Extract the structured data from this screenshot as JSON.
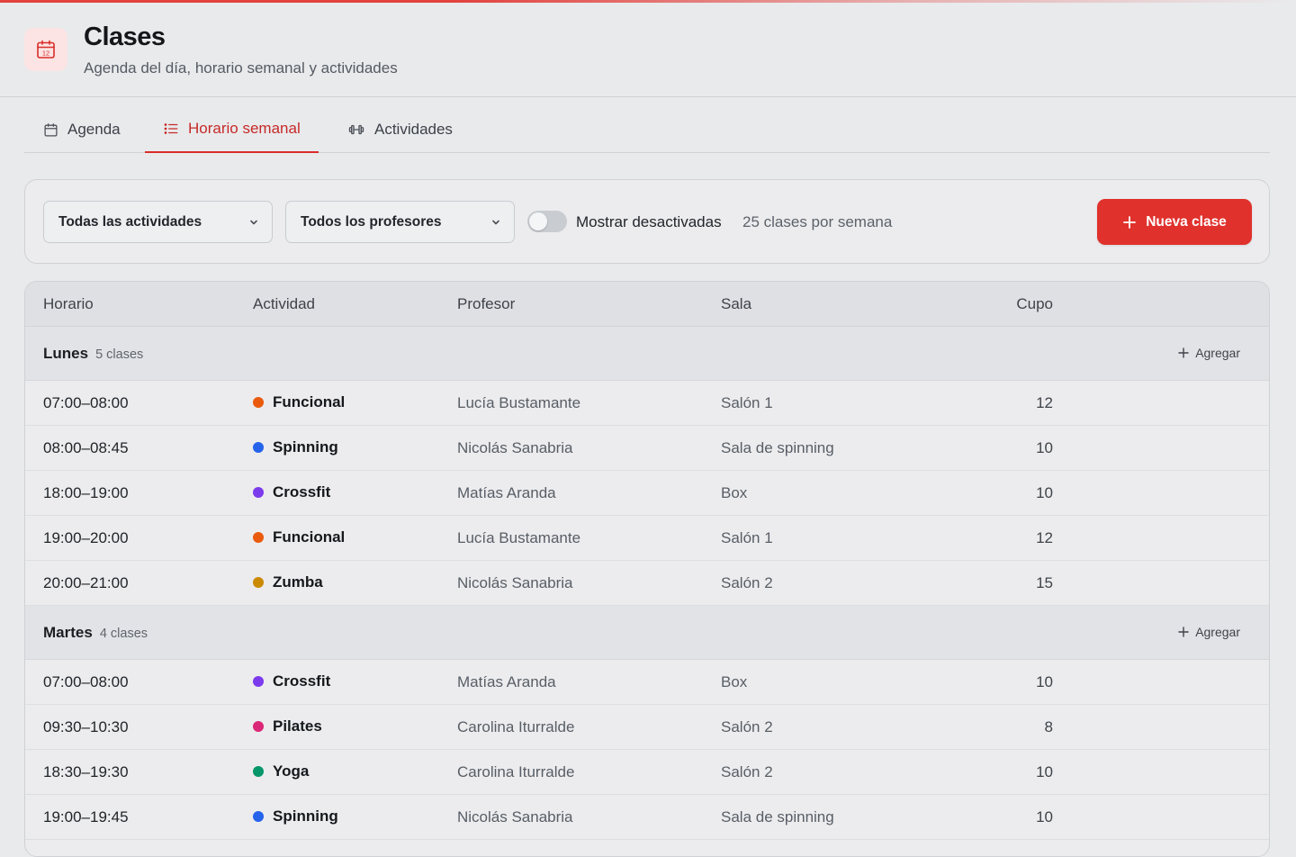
{
  "header": {
    "title": "Clases",
    "subtitle": "Agenda del día, horario semanal y actividades",
    "icon": "calendar-icon",
    "icon_day": "12"
  },
  "tabs": [
    {
      "label": "Agenda",
      "icon": "calendar-icon",
      "active": false
    },
    {
      "label": "Horario semanal",
      "icon": "list-icon",
      "active": true
    },
    {
      "label": "Actividades",
      "icon": "dumbbell-icon",
      "active": false
    }
  ],
  "filters": {
    "activity_select": "Todas las actividades",
    "teacher_select": "Todos los profesores",
    "toggle_label": "Mostrar desactivadas",
    "toggle_on": false,
    "count_label": "25 clases por semana",
    "new_button": "Nueva clase"
  },
  "table": {
    "columns": [
      "Horario",
      "Actividad",
      "Profesor",
      "Sala",
      "Cupo"
    ],
    "add_label": "Agregar",
    "groups": [
      {
        "day": "Lunes",
        "count": "5 clases",
        "rows": [
          {
            "time": "07:00–08:00",
            "activity": "Funcional",
            "color": "#ea5a0c",
            "teacher": "Lucía Bustamante",
            "room": "Salón 1",
            "cupo": "12"
          },
          {
            "time": "08:00–08:45",
            "activity": "Spinning",
            "color": "#2563eb",
            "teacher": "Nicolás Sanabria",
            "room": "Sala de spinning",
            "cupo": "10"
          },
          {
            "time": "18:00–19:00",
            "activity": "Crossfit",
            "color": "#7c3aed",
            "teacher": "Matías Aranda",
            "room": "Box",
            "cupo": "10"
          },
          {
            "time": "19:00–20:00",
            "activity": "Funcional",
            "color": "#ea5a0c",
            "teacher": "Lucía Bustamante",
            "room": "Salón 1",
            "cupo": "12"
          },
          {
            "time": "20:00–21:00",
            "activity": "Zumba",
            "color": "#ca8a04",
            "teacher": "Nicolás Sanabria",
            "room": "Salón 2",
            "cupo": "15"
          }
        ]
      },
      {
        "day": "Martes",
        "count": "4 clases",
        "rows": [
          {
            "time": "07:00–08:00",
            "activity": "Crossfit",
            "color": "#7c3aed",
            "teacher": "Matías Aranda",
            "room": "Box",
            "cupo": "10"
          },
          {
            "time": "09:30–10:30",
            "activity": "Pilates",
            "color": "#db2777",
            "teacher": "Carolina Iturralde",
            "room": "Salón 2",
            "cupo": "8"
          },
          {
            "time": "18:30–19:30",
            "activity": "Yoga",
            "color": "#059669",
            "teacher": "Carolina Iturralde",
            "room": "Salón 2",
            "cupo": "10"
          },
          {
            "time": "19:00–19:45",
            "activity": "Spinning",
            "color": "#2563eb",
            "teacher": "Nicolás Sanabria",
            "room": "Sala de spinning",
            "cupo": "10"
          }
        ]
      }
    ]
  },
  "colors": {
    "accent": "#e0312c",
    "active_tab": "#c62a28"
  }
}
